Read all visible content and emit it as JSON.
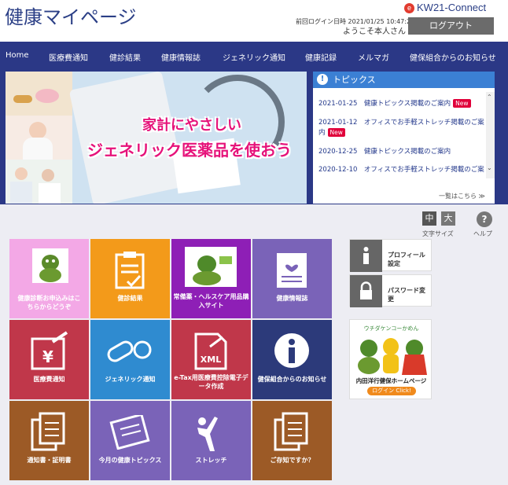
{
  "header": {
    "site_title": "健康マイページ",
    "brand": "KW21-Connect",
    "last_login": "前回ログイン日時 2021/01/25 10:47:20",
    "welcome": "ようこそ本人さん",
    "logout": "ログアウト"
  },
  "nav": [
    "Home",
    "医療費通知",
    "健診結果",
    "健康情報誌",
    "ジェネリック通知",
    "健康記録",
    "メルマガ",
    "健保組合からのお知らせ"
  ],
  "banner": {
    "line1": "家計にやさしい",
    "line2": "ジェネリック医薬品を使おう"
  },
  "topics": {
    "title": "トピックス",
    "new_label": "New",
    "items": [
      {
        "text": "2021-01-25　健康トピックス掲載のご案内",
        "new": true
      },
      {
        "text": "2021-01-12　オフィスでお手軽ストレッチ掲載のご案内",
        "new": true
      },
      {
        "text": "2020-12-25　健康トピックス掲載のご案内",
        "new": false
      },
      {
        "text": "2020-12-10　オフィスでお手軽ストレッチ掲載のご案",
        "new": false
      }
    ],
    "more": "一覧はこちら"
  },
  "font_size": {
    "medium": "中",
    "large": "大",
    "label": "文字サイズ"
  },
  "help": {
    "icon": "?",
    "label": "ヘルプ"
  },
  "tiles": [
    {
      "label": "健康診断お申込みはこちらからどうぞ",
      "color": "#f3a8e6",
      "icon": "mascot-icon"
    },
    {
      "label": "健診結果",
      "color": "#f39a1a",
      "icon": "clipboard-check-icon"
    },
    {
      "label": "常備薬・ヘルスケア用品購入サイト",
      "color": "#8e1fb6",
      "icon": "mascot-icon"
    },
    {
      "label": "健康情報誌",
      "color": "#7a63b8",
      "icon": "magazine-heart-icon"
    },
    {
      "label": "医療費通知",
      "color": "#c0374a",
      "icon": "yen-syringe-icon"
    },
    {
      "label": "ジェネリック通知",
      "color": "#2f8bd0",
      "icon": "pills-icon"
    },
    {
      "label": "e-Tax用医療費控除電子データ作成",
      "color": "#c0374a",
      "icon": "xml-file-icon"
    },
    {
      "label": "健保組合からのお知らせ",
      "color": "#2c3a7a",
      "icon": "info-icon"
    },
    {
      "label": "通知書・証明書",
      "color": "#9c5a26",
      "icon": "documents-icon"
    },
    {
      "label": "今月の健康トピックス",
      "color": "#7a63b8",
      "icon": "newspaper-icon"
    },
    {
      "label": "ストレッチ",
      "color": "#7a63b8",
      "icon": "stretch-figure-icon"
    },
    {
      "label": "ご存知ですか？",
      "color": "#9c5a26",
      "icon": "documents-icon"
    }
  ],
  "side": {
    "profile": "プロフィール設定",
    "password": "パスワード変更",
    "mascot": {
      "caption": "ウチダケンコーかめん",
      "title": "内田洋行健保ホームページ",
      "login": "ログイン Click!"
    }
  }
}
